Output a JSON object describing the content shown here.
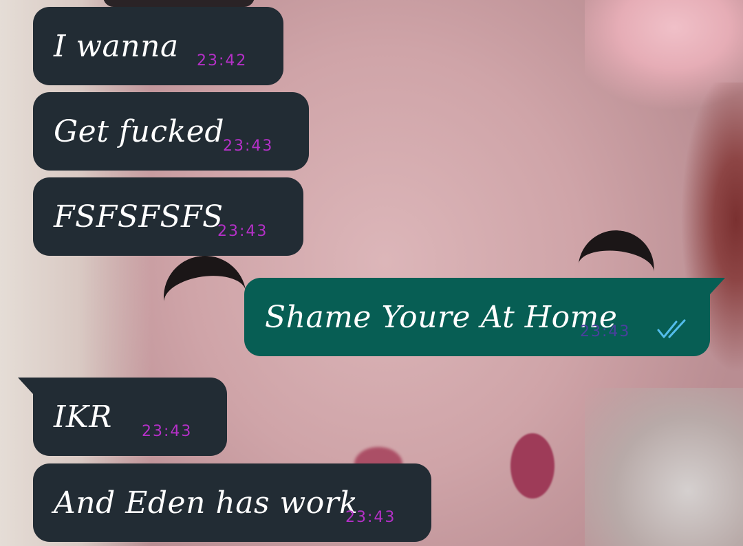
{
  "conversation": {
    "messages": [
      {
        "direction": "incoming",
        "text": "I wanna",
        "time": "23:42"
      },
      {
        "direction": "incoming",
        "text": "Get fucked",
        "time": "23:43"
      },
      {
        "direction": "incoming",
        "text": "FSFSFSFS",
        "time": "23:43"
      },
      {
        "direction": "outgoing",
        "text": "Shame Youre At Home",
        "time": "23:43",
        "status_icon": "double-check-read-icon"
      },
      {
        "direction": "incoming",
        "text": "IKR",
        "time": "23:43"
      },
      {
        "direction": "incoming",
        "text": "And Eden has work",
        "time": "23:43"
      }
    ]
  },
  "colors": {
    "incoming_bubble": "#222c34",
    "outgoing_bubble": "#075e54",
    "incoming_time": "#b530c8",
    "outgoing_time": "#4b3f9e",
    "read_ticks": "#53bdeb"
  }
}
